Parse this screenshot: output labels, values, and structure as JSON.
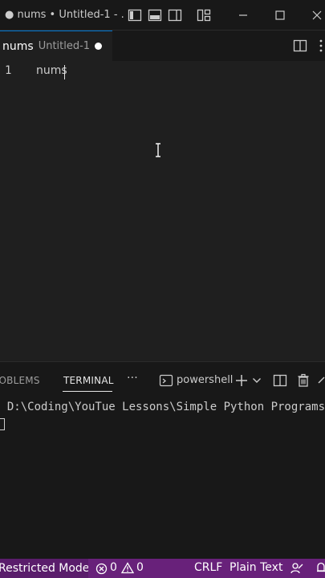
{
  "window": {
    "title": "● nums • Untitled-1 - ..."
  },
  "tab": {
    "name": "nums",
    "description": "Untitled-1"
  },
  "editor": {
    "line_number": "1",
    "line_text": "nums"
  },
  "panel": {
    "tabs": {
      "problems": "ROBLEMS",
      "terminal": "TERMINAL",
      "more": "···"
    },
    "shell_label": "powershell",
    "terminal_line": "S D:\\Coding\\YouTue Lessons\\Simple Python Programs>"
  },
  "statusbar": {
    "restricted": "Restricted Mode",
    "errors": "0",
    "warnings": "0",
    "eol": "CRLF",
    "language": "Plain Text"
  },
  "colors": {
    "accent": "#0078d4",
    "statusbar": "#68217a"
  }
}
